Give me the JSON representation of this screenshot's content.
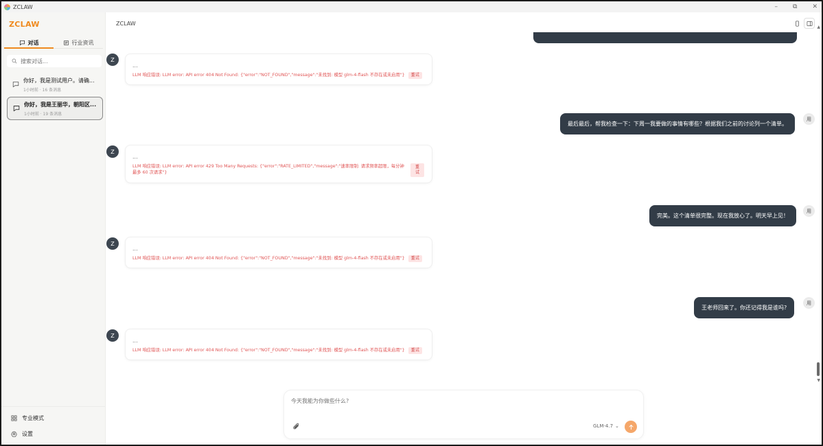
{
  "window": {
    "title": "ZCLAW",
    "controls": [
      "–",
      "⧉",
      "✕"
    ]
  },
  "sidebar": {
    "brand": "ZCLAW",
    "tabs": [
      {
        "label": "对话",
        "icon": "chat-icon",
        "active": true
      },
      {
        "label": "行业资讯",
        "icon": "news-icon",
        "active": false
      }
    ],
    "search_placeholder": "搜索对话...",
    "conversations": [
      {
        "title": "你好，我是测试用户。请确...",
        "meta": "1小时前 · 16 条消息",
        "selected": false
      },
      {
        "title": "你好，我是王丽华，朝阳区...",
        "meta": "1小时前 · 19 条消息",
        "selected": true
      }
    ],
    "bottom": [
      {
        "label": "专业模式",
        "icon": "grid-icon"
      },
      {
        "label": "设置",
        "icon": "gear-icon"
      }
    ]
  },
  "main": {
    "title": "ZCLAW",
    "messages": [
      {
        "role": "assistant",
        "avatar": "Z",
        "dots": "...",
        "error": "LLM 响应错误: LLM error: API error 404 Not Found: {\"error\":\"NOT_FOUND\",\"message\":\"未找到: 模型 glm-4-flash 不存在或未启用\"}",
        "retry": "重试"
      },
      {
        "role": "user",
        "avatar": "用",
        "text": "最后最后，帮我检查一下：下周一我要做的事情有哪些？根据我们之前的讨论列一个清单。"
      },
      {
        "role": "assistant",
        "avatar": "Z",
        "dots": "...",
        "error": "LLM 响应错误: LLM error: API error 429 Too Many Requests: {\"error\":\"RATE_LIMITED\",\"message\":\"速率限制: 请求频率超限，每分钟最多 60 次请求\"}",
        "retry": "重试"
      },
      {
        "role": "user",
        "avatar": "用",
        "text": "完美。这个清单很完整。现在我放心了。明天早上见！"
      },
      {
        "role": "assistant",
        "avatar": "Z",
        "dots": "...",
        "error": "LLM 响应错误: LLM error: API error 404 Not Found: {\"error\":\"NOT_FOUND\",\"message\":\"未找到: 模型 glm-4-flash 不存在或未启用\"}",
        "retry": "重试"
      },
      {
        "role": "user",
        "avatar": "用",
        "text": "王老师回来了。你还记得我是谁吗?"
      },
      {
        "role": "assistant",
        "avatar": "Z",
        "dots": "...",
        "error": "LLM 响应错误: LLM error: API error 404 Not Found: {\"error\":\"NOT_FOUND\",\"message\":\"未找到: 模型 glm-4-flash 不存在或未启用\"}",
        "retry": "重试"
      }
    ]
  },
  "composer": {
    "placeholder": "今天我能为你做些什么?",
    "model": "GLM-4.7",
    "model_chevron": "⌄"
  },
  "colors": {
    "accent": "#ef8a1e",
    "user_bubble": "#323c47",
    "error_text": "#e05454",
    "send_button": "#f5a76a"
  }
}
